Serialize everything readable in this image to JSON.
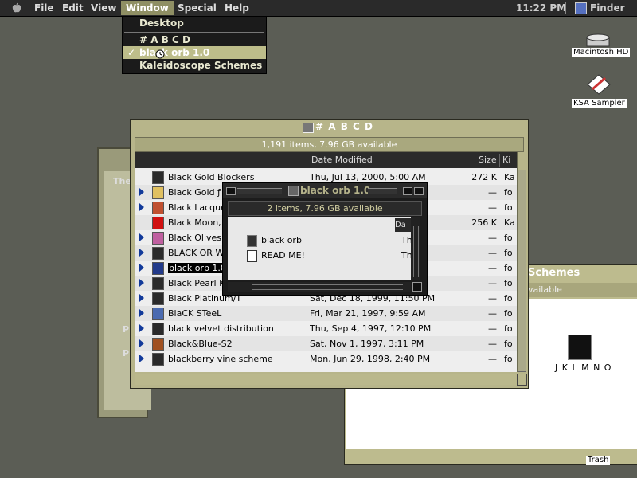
{
  "menubar": {
    "items": [
      "File",
      "Edit",
      "View",
      "Window",
      "Special",
      "Help"
    ],
    "active": "Window",
    "clock": "11:22 PM",
    "app": "Finder"
  },
  "window_menu": {
    "items": [
      {
        "label": "Desktop",
        "checked": false,
        "selected": false
      },
      {
        "label": "# A B C D",
        "checked": false,
        "selected": false
      },
      {
        "label": "black orb 1.0",
        "checked": true,
        "selected": true
      },
      {
        "label": "Kaleidoscope Schemes",
        "checked": false,
        "selected": false
      }
    ],
    "check_mark": "✓"
  },
  "desktop_icons": [
    {
      "label": "Macintosh HD",
      "icon": "hard-disk-icon"
    },
    {
      "label": "KSA Sampler",
      "icon": "app-icon"
    },
    {
      "label": "Trash",
      "icon": "trash-icon"
    }
  ],
  "background_window": {
    "visible_text": [
      "The",
      "P",
      "P"
    ]
  },
  "kaleidoscope_window": {
    "title_fragment": "Schemes",
    "info_fragment": "vailable",
    "item_label": "J K L M N O"
  },
  "main_window": {
    "title": "# A B C D",
    "info": "1,191 items, 7.96 GB available",
    "columns": {
      "date": "Date Modified",
      "size": "Size",
      "kind": "Ki"
    },
    "rows": [
      {
        "name": "Black Gold Blockers",
        "date": "Thu, Jul 13, 2000, 5:00 AM",
        "size": "272 K",
        "kind": "Ka",
        "folder": false
      },
      {
        "name": "Black Gold ƒ",
        "date": "",
        "size": "—",
        "kind": "fo",
        "folder": true
      },
      {
        "name": "Black Lacquer",
        "date": "",
        "size": "—",
        "kind": "fo",
        "folder": true
      },
      {
        "name": "Black Moon, R",
        "date": "",
        "size": "256 K",
        "kind": "Ka",
        "folder": false
      },
      {
        "name": "Black Olives &",
        "date": "",
        "size": "—",
        "kind": "fo",
        "folder": true
      },
      {
        "name": "BLACK OR WH",
        "date": "",
        "size": "—",
        "kind": "fo",
        "folder": true
      },
      {
        "name": "black orb 1.0",
        "date": "",
        "size": "—",
        "kind": "fo",
        "folder": true
      },
      {
        "name": "Black Pearl Ka",
        "date": "",
        "size": "—",
        "kind": "fo",
        "folder": true
      },
      {
        "name": "Black Platinum/T",
        "date": "Sat, Dec 18, 1999, 11:50 PM",
        "size": "—",
        "kind": "fo",
        "folder": true
      },
      {
        "name": "BlaCK STeeL",
        "date": "Fri, Mar 21, 1997, 9:59 AM",
        "size": "—",
        "kind": "fo",
        "folder": true
      },
      {
        "name": "black velvet distribution",
        "date": "Thu, Sep 4, 1997, 12:10 PM",
        "size": "—",
        "kind": "fo",
        "folder": true
      },
      {
        "name": "Black&Blue-S2",
        "date": "Sat, Nov 1, 1997, 3:11 PM",
        "size": "—",
        "kind": "fo",
        "folder": true
      },
      {
        "name": "blackberry vine scheme",
        "date": "Mon, Jun 29, 1998, 2:40 PM",
        "size": "—",
        "kind": "fo",
        "folder": true
      }
    ]
  },
  "orb_window": {
    "title": "black orb 1.0",
    "info": "2 items, 7.96 GB available",
    "date_header": "Da",
    "rows": [
      {
        "name": "black orb",
        "date": "Th",
        "icon": "folder-icon"
      },
      {
        "name": "READ ME!",
        "date": "Th",
        "icon": "document-icon"
      }
    ]
  }
}
